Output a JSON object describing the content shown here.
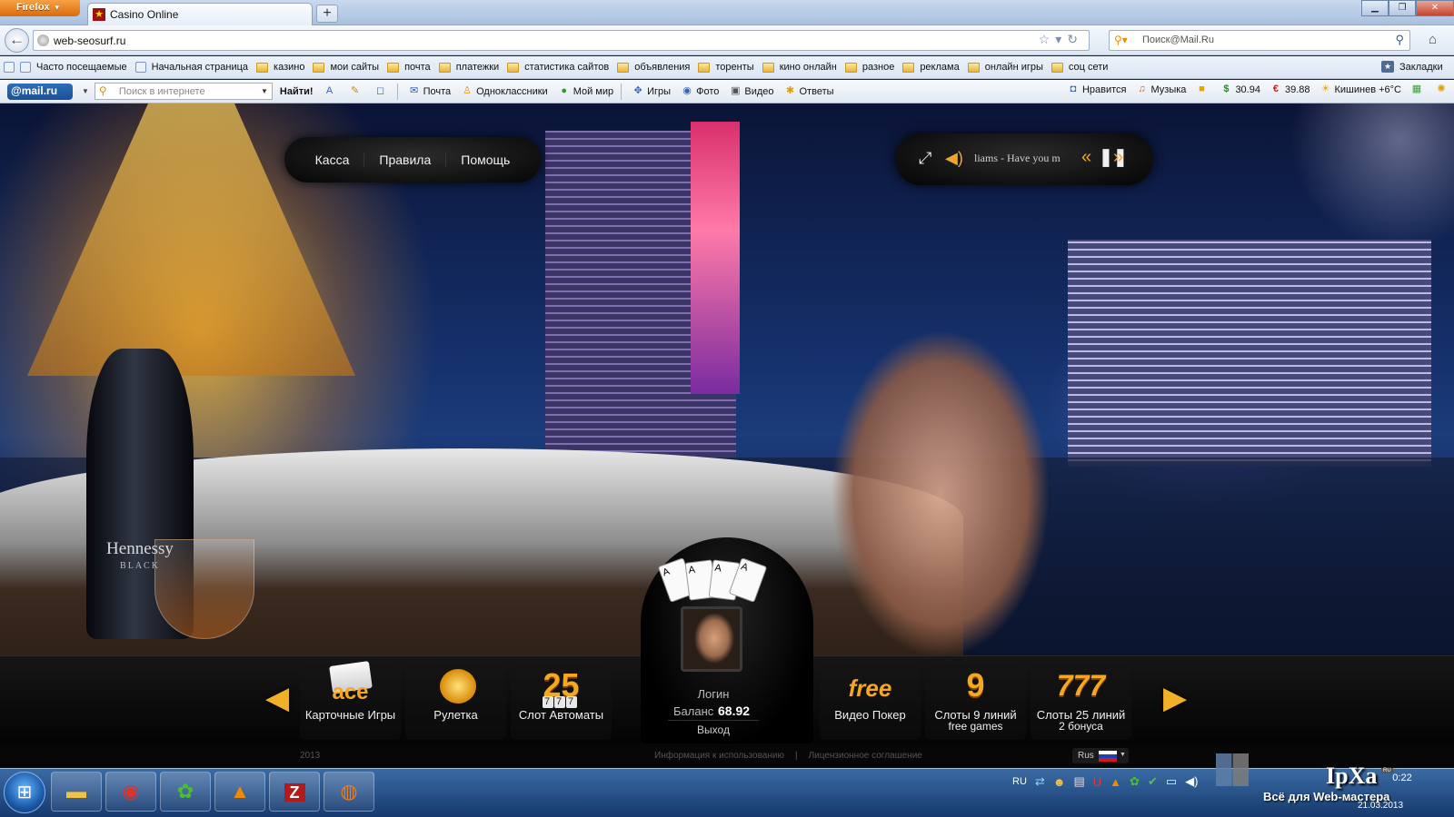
{
  "browser": {
    "menu_label": "Firefox",
    "tab_title": "Casino Online",
    "new_tab_label": "+",
    "url": "web-seosurf.ru",
    "search_placeholder": "Поиск@Mail.Ru",
    "bookmarks": [
      {
        "label": "Часто посещаемые",
        "icon": "page-icon"
      },
      {
        "label": "Начальная страница",
        "icon": "page-icon"
      },
      {
        "label": "казино",
        "icon": "folder-icon"
      },
      {
        "label": "мои сайты",
        "icon": "folder-icon"
      },
      {
        "label": "почта",
        "icon": "folder-icon"
      },
      {
        "label": "платежки",
        "icon": "folder-icon"
      },
      {
        "label": "статистика сайтов",
        "icon": "folder-icon"
      },
      {
        "label": "объявления",
        "icon": "folder-icon"
      },
      {
        "label": "торенты",
        "icon": "folder-icon"
      },
      {
        "label": "кино онлайн",
        "icon": "folder-icon"
      },
      {
        "label": "разное",
        "icon": "folder-icon"
      },
      {
        "label": "реклама",
        "icon": "folder-icon"
      },
      {
        "label": "онлайн игры",
        "icon": "folder-icon"
      },
      {
        "label": "соц сети",
        "icon": "folder-icon"
      }
    ],
    "bookmarks_menu": "Закладки"
  },
  "mail_toolbar": {
    "logo": "@mail.ru",
    "search_placeholder": "Поиск в интернете",
    "find_button": "Найти!",
    "items": [
      "Почта",
      "Одноклассники",
      "Мой мир",
      "Игры",
      "Фото",
      "Видео",
      "Ответы"
    ],
    "right_items": {
      "like": "Нравится",
      "music": "Музыка",
      "usd": "30.94",
      "eur": "39.88",
      "weather": "Кишинев +6°C"
    }
  },
  "site": {
    "menu": [
      "Касса",
      "Правила",
      "Помощь"
    ],
    "player_track": "liams - Have you m",
    "bottle_brand": "Hennessy",
    "bottle_sub": "BLACK",
    "games_left": [
      {
        "icon_text": "ace",
        "label": "Карточные Игры",
        "sub": ""
      },
      {
        "icon_text": "",
        "label": "Рулетка",
        "sub": ""
      },
      {
        "icon_text": "25",
        "label": "Слот Автоматы",
        "sub": ""
      }
    ],
    "games_right": [
      {
        "icon_text": "free",
        "label": "Видео Покер",
        "sub": ""
      },
      {
        "icon_text": "9",
        "label": "Слоты 9 линий",
        "sub": "free games"
      },
      {
        "icon_text": "777",
        "label": "Слоты 25 линий",
        "sub": "2 бонуса"
      }
    ],
    "reels": [
      "7",
      "7",
      "7"
    ],
    "fan_cards": [
      "A",
      "A",
      "A",
      "A"
    ],
    "user": {
      "login_label": "Логин",
      "balance_label": "Баланс",
      "balance_value": "68.92",
      "logout_label": "Выход"
    },
    "footer": {
      "year": "2013",
      "info_link": "Информация к использованию",
      "separator": "|",
      "license_link": "Лицензионное соглашение",
      "language": "Rus"
    }
  },
  "taskbar": {
    "lang": "RU",
    "time": "0:22",
    "date": "21.03.2013"
  },
  "watermark": {
    "logo": "IpXa",
    "tag": "RU",
    "motto": "Всё для Web-мастера"
  }
}
